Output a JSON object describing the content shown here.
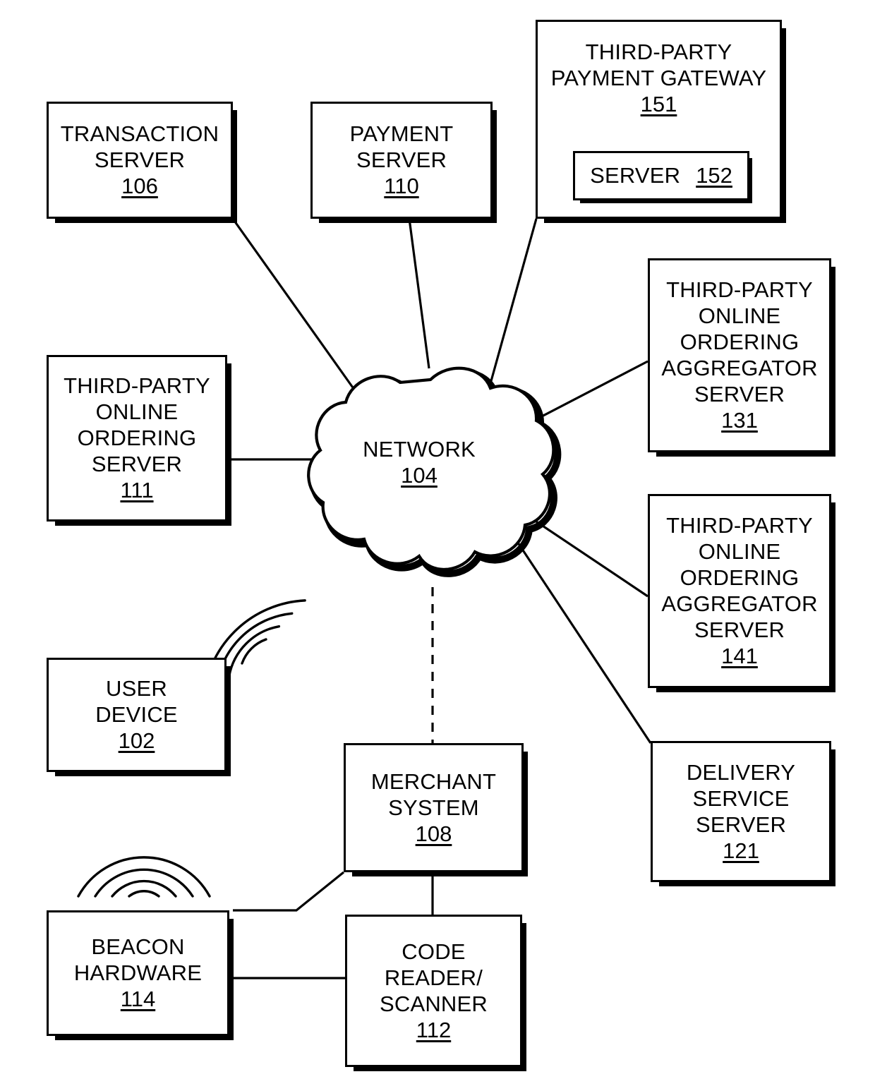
{
  "figure": {
    "type": "system-block-diagram",
    "background": "#ffffff",
    "line_color": "#000000"
  },
  "nodes": [
    {
      "id": "transaction-server",
      "title": "TRANSACTION\nSERVER",
      "ref": "106"
    },
    {
      "id": "payment-server",
      "title": "PAYMENT\nSERVER",
      "ref": "110"
    },
    {
      "id": "payment-gateway",
      "title": "THIRD-PARTY\nPAYMENT GATEWAY",
      "ref": "151"
    },
    {
      "id": "gateway-server",
      "title": "SERVER",
      "ref": "152"
    },
    {
      "id": "ordering-server",
      "title": "THIRD-PARTY\nONLINE\nORDERING\nSERVER",
      "ref": "111"
    },
    {
      "id": "aggregator-131",
      "title": "THIRD-PARTY\nONLINE\nORDERING\nAGGREGATOR\nSERVER",
      "ref": "131"
    },
    {
      "id": "aggregator-141",
      "title": "THIRD-PARTY\nONLINE\nORDERING\nAGGREGATOR\nSERVER",
      "ref": "141"
    },
    {
      "id": "delivery-server",
      "title": "DELIVERY\nSERVICE\nSERVER",
      "ref": "121"
    },
    {
      "id": "user-device",
      "title": "USER\nDEVICE",
      "ref": "102"
    },
    {
      "id": "merchant-system",
      "title": "MERCHANT\nSYSTEM",
      "ref": "108"
    },
    {
      "id": "beacon-hardware",
      "title": "BEACON\nHARDWARE",
      "ref": "114"
    },
    {
      "id": "code-reader",
      "title": "CODE\nREADER/\nSCANNER",
      "ref": "112"
    }
  ],
  "cloud": {
    "id": "network-cloud",
    "title": "NETWORK",
    "ref": "104"
  },
  "connections": [
    {
      "from": "transaction-server",
      "to": "network-cloud",
      "style": "solid"
    },
    {
      "from": "payment-server",
      "to": "network-cloud",
      "style": "solid"
    },
    {
      "from": "payment-gateway",
      "to": "network-cloud",
      "style": "solid"
    },
    {
      "from": "ordering-server",
      "to": "network-cloud",
      "style": "solid"
    },
    {
      "from": "aggregator-131",
      "to": "network-cloud",
      "style": "solid"
    },
    {
      "from": "aggregator-141",
      "to": "network-cloud",
      "style": "solid"
    },
    {
      "from": "delivery-server",
      "to": "network-cloud",
      "style": "solid"
    },
    {
      "from": "network-cloud",
      "to": "merchant-system",
      "style": "dashed"
    },
    {
      "from": "merchant-system",
      "to": "beacon-hardware",
      "style": "solid"
    },
    {
      "from": "merchant-system",
      "to": "code-reader",
      "style": "solid"
    },
    {
      "from": "beacon-hardware",
      "to": "code-reader",
      "style": "solid"
    },
    {
      "from": "beacon-hardware",
      "to": "user-device",
      "style": "wireless"
    },
    {
      "from": "beacon-hardware",
      "to": "network-cloud",
      "style": "wireless"
    }
  ],
  "wireless_indicators": [
    {
      "id": "beacon-to-network-waves",
      "arc_count": 4
    },
    {
      "id": "beacon-to-user-waves",
      "arc_count": 4
    }
  ]
}
